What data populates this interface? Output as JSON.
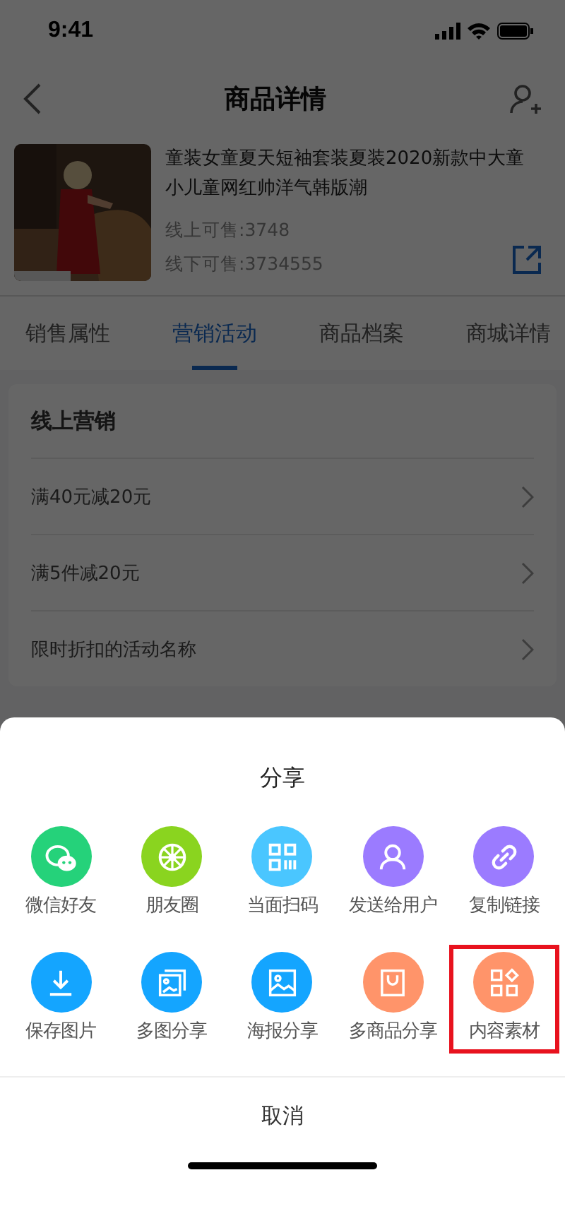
{
  "status_bar": {
    "time": "9:41"
  },
  "nav": {
    "title": "商品详情"
  },
  "product": {
    "kind": "picture",
    "title": "童装女童夏天短袖套装夏装2020新款中大童小儿童网红帅洋气韩版潮",
    "online": "线上可售:3748",
    "offline": "线下可售:3734555"
  },
  "tabs": [
    {
      "label": "销售属性",
      "selected": false
    },
    {
      "label": "营销活动",
      "selected": true
    },
    {
      "label": "商品档案",
      "selected": false
    },
    {
      "label": "商城详情",
      "selected": false
    }
  ],
  "section": {
    "title": "线上营销",
    "items": [
      {
        "label": "满40元减20元"
      },
      {
        "label": "满5件减20元"
      },
      {
        "label": "限时折扣的活动名称"
      }
    ]
  },
  "share": {
    "title": "分享",
    "items": [
      {
        "label": "微信好友",
        "kind": "wechat",
        "color": "#25d27a",
        "highlighted": false
      },
      {
        "label": "朋友圈",
        "kind": "moments",
        "color": "#8ad41f",
        "highlighted": false
      },
      {
        "label": "当面扫码",
        "kind": "qrcode",
        "color": "#4ac6ff",
        "highlighted": false
      },
      {
        "label": "发送给用户",
        "kind": "user",
        "color": "#9b7bff",
        "highlighted": false
      },
      {
        "label": "复制链接",
        "kind": "link",
        "color": "#9b7bff",
        "highlighted": false
      },
      {
        "label": "保存图片",
        "kind": "download",
        "color": "#14a5ff",
        "highlighted": false
      },
      {
        "label": "多图分享",
        "kind": "images",
        "color": "#14a5ff",
        "highlighted": false
      },
      {
        "label": "海报分享",
        "kind": "poster",
        "color": "#14a5ff",
        "highlighted": false
      },
      {
        "label": "多商品分享",
        "kind": "bag",
        "color": "#ff946a",
        "highlighted": false
      },
      {
        "label": "内容素材",
        "kind": "grid",
        "color": "#ff946a",
        "highlighted": true
      }
    ],
    "cancel": "取消"
  }
}
